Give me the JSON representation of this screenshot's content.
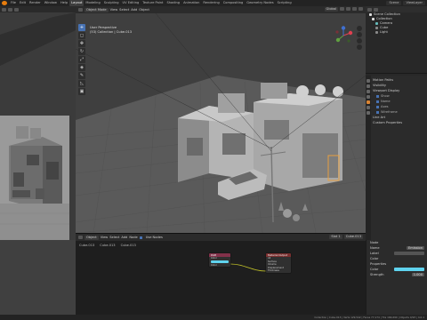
{
  "app": {
    "title": "Blender 4.0.1",
    "menus": [
      "File",
      "Edit",
      "Render",
      "Window",
      "Help"
    ],
    "workspaces": [
      "Layout",
      "Modeling",
      "Sculpting",
      "UV Editing",
      "Texture Paint",
      "Shading",
      "Animation",
      "Rendering",
      "Compositing",
      "Geometry Nodes",
      "Scripting"
    ],
    "active_workspace": "Layout",
    "scene": "Scene",
    "view_layer": "ViewLayer"
  },
  "viewport": {
    "mode": "Object Mode",
    "menus": [
      "View",
      "Select",
      "Add",
      "Object"
    ],
    "transform": "Global",
    "info_line1": "User Perspective",
    "info_line2": "(53) Collection | Cube.013",
    "tools": [
      "cursor-icon",
      "select-icon",
      "move-icon",
      "rotate-icon",
      "scale-icon",
      "transform-icon",
      "annotate-icon",
      "measure-icon",
      "add-cube-icon"
    ]
  },
  "outliner": {
    "title": "Scene Collection",
    "rows": [
      {
        "label": "Scene Collection",
        "level": 0
      },
      {
        "label": "Collection",
        "level": 1
      },
      {
        "label": "Camera",
        "level": 2
      },
      {
        "label": "Cube",
        "level": 2
      },
      {
        "label": "Light",
        "level": 2
      }
    ]
  },
  "properties": {
    "rows": [
      {
        "label": "Motion Paths",
        "sub": false
      },
      {
        "label": "Visibility",
        "sub": false
      },
      {
        "label": "Viewport Display",
        "sub": false
      },
      {
        "label": "Show",
        "sub": true
      },
      {
        "label": "Name",
        "sub": true
      },
      {
        "label": "Axes",
        "sub": true
      },
      {
        "label": "Wireframe",
        "sub": true
      },
      {
        "label": "Line Art",
        "sub": false
      },
      {
        "label": "Custom Properties",
        "sub": false
      }
    ]
  },
  "shader_editor": {
    "type": "Object",
    "menus": [
      "View",
      "Select",
      "Add",
      "Node"
    ],
    "use_nodes": "Use Nodes",
    "slot": "Slot 1",
    "material": "Cube.013",
    "sub_labels": [
      "Cube.013",
      "Cube.013",
      "Cube.013"
    ],
    "node1": {
      "title": "RGB",
      "rows": [
        "Color",
        "",
        "Color"
      ]
    },
    "node2": {
      "title": "Material Output",
      "rows": [
        "All",
        "Surface",
        "Volume",
        "Displacement",
        "Thickness"
      ]
    }
  },
  "node_npanel": {
    "section": "Node",
    "name_label": "Name",
    "name_value": "Emission",
    "label_label": "Label",
    "color_label": "Color",
    "properties_section": "Properties",
    "strength_label": "Strength",
    "strength_value": "1.000"
  },
  "statusbar": {
    "text": "Collection | Cube.013 | Verts 129,542 | Faces 77,174 | Tris 166,690 | Objects 0/93 | 4.0.1"
  },
  "colors": {
    "accent": "#4772b3",
    "emission_color": "#5fd3ee",
    "blender_orange": "#e87d0d",
    "node_header_input": "#83314a",
    "node_header_output": "#7a2f2f"
  }
}
